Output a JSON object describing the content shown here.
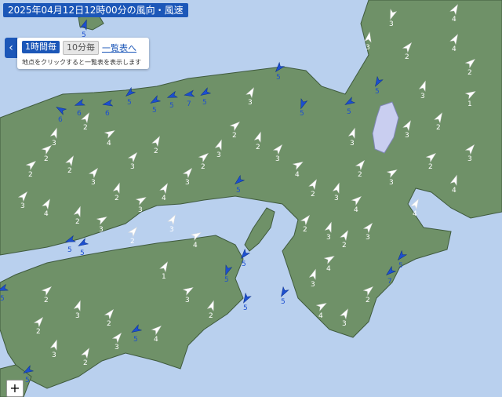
{
  "header": {
    "title": "2025年04月12日12時00分の風向・風速"
  },
  "controls": {
    "tab_hourly": "1時間毎",
    "tab_10min": "10分毎",
    "list_link": "一覧表へ",
    "hint": "地点をクリックすると一覧表を表示します",
    "collapse_icon": "chevron-left-icon",
    "zoom_in": "+"
  },
  "colors": {
    "land": "#6f9168",
    "sea": "#b9d0ee",
    "lake": "#c9cef0",
    "strong_wind": "#1c4fd0",
    "title_bg": "#1c57b8"
  },
  "stations": [
    {
      "speed": "5",
      "strong": true
    },
    {
      "speed": "3",
      "strong": false
    },
    {
      "speed": "4",
      "strong": false
    },
    {
      "speed": "3",
      "strong": false
    },
    {
      "speed": "6",
      "strong": true
    },
    {
      "speed": "6",
      "strong": true
    },
    {
      "speed": "6",
      "strong": true
    },
    {
      "speed": "5",
      "strong": true
    },
    {
      "speed": "5",
      "strong": true
    },
    {
      "speed": "5",
      "strong": true
    },
    {
      "speed": "7",
      "strong": true
    },
    {
      "speed": "5",
      "strong": true
    },
    {
      "speed": "5",
      "strong": true
    },
    {
      "speed": "5",
      "strong": true
    },
    {
      "speed": "5",
      "strong": true
    },
    {
      "speed": "5",
      "strong": true
    },
    {
      "speed": "5",
      "strong": true
    },
    {
      "speed": "5",
      "strong": true
    },
    {
      "speed": "5",
      "strong": true
    },
    {
      "speed": "5",
      "strong": true
    },
    {
      "speed": "5",
      "strong": true
    },
    {
      "speed": "5",
      "strong": true
    },
    {
      "speed": "5",
      "strong": true
    },
    {
      "speed": "5",
      "strong": true
    },
    {
      "speed": "7",
      "strong": true
    },
    {
      "speed": "5",
      "strong": true
    },
    {
      "speed": "5",
      "strong": true
    },
    {
      "speed": "5",
      "strong": true
    },
    {
      "speed": "3",
      "strong": false
    },
    {
      "speed": "2",
      "strong": false
    },
    {
      "speed": "2",
      "strong": false
    },
    {
      "speed": "3",
      "strong": false
    },
    {
      "speed": "4",
      "strong": false
    },
    {
      "speed": "2",
      "strong": false
    },
    {
      "speed": "3",
      "strong": false
    },
    {
      "speed": "4",
      "strong": false
    },
    {
      "speed": "3",
      "strong": false
    },
    {
      "speed": "2",
      "strong": false
    },
    {
      "speed": "4",
      "strong": false
    },
    {
      "speed": "3",
      "strong": false
    },
    {
      "speed": "2",
      "strong": false
    },
    {
      "speed": "2",
      "strong": false
    },
    {
      "speed": "3",
      "strong": false
    },
    {
      "speed": "2",
      "strong": false
    },
    {
      "speed": "3",
      "strong": false
    },
    {
      "speed": "4",
      "strong": false
    },
    {
      "speed": "3",
      "strong": false
    },
    {
      "speed": "2",
      "strong": false
    },
    {
      "speed": "3",
      "strong": false
    },
    {
      "speed": "2",
      "strong": false
    },
    {
      "speed": "3",
      "strong": false
    },
    {
      "speed": "4",
      "strong": false
    },
    {
      "speed": "2",
      "strong": false
    },
    {
      "speed": "3",
      "strong": false
    },
    {
      "speed": "2",
      "strong": false
    },
    {
      "speed": "3",
      "strong": false
    },
    {
      "speed": "4",
      "strong": false
    },
    {
      "speed": "2",
      "strong": false
    },
    {
      "speed": "3",
      "strong": false
    },
    {
      "speed": "2",
      "strong": false
    },
    {
      "speed": "3",
      "strong": false
    },
    {
      "speed": "2",
      "strong": false
    },
    {
      "speed": "4",
      "strong": false
    },
    {
      "speed": "3",
      "strong": false
    },
    {
      "speed": "2",
      "strong": false
    },
    {
      "speed": "1",
      "strong": false
    },
    {
      "speed": "3",
      "strong": false
    },
    {
      "speed": "2",
      "strong": false
    },
    {
      "speed": "2",
      "strong": false
    },
    {
      "speed": "4",
      "strong": false
    },
    {
      "speed": "3",
      "strong": false
    },
    {
      "speed": "2",
      "strong": false
    },
    {
      "speed": "3",
      "strong": false
    },
    {
      "speed": "4",
      "strong": false
    },
    {
      "speed": "2",
      "strong": false
    },
    {
      "speed": "3",
      "strong": false
    },
    {
      "speed": "2",
      "strong": false
    },
    {
      "speed": "1",
      "strong": false
    },
    {
      "speed": "3",
      "strong": false
    },
    {
      "speed": "2",
      "strong": false
    },
    {
      "speed": "4",
      "strong": false
    },
    {
      "speed": "3",
      "strong": false
    },
    {
      "speed": "2",
      "strong": false
    },
    {
      "speed": "3",
      "strong": false
    },
    {
      "speed": "2",
      "strong": false
    },
    {
      "speed": "4",
      "strong": false
    },
    {
      "speed": "3",
      "strong": false
    },
    {
      "speed": "2",
      "strong": false
    },
    {
      "speed": "3",
      "strong": false
    },
    {
      "speed": "2",
      "strong": false
    },
    {
      "speed": "3",
      "strong": false
    },
    {
      "speed": "4",
      "strong": false
    }
  ]
}
